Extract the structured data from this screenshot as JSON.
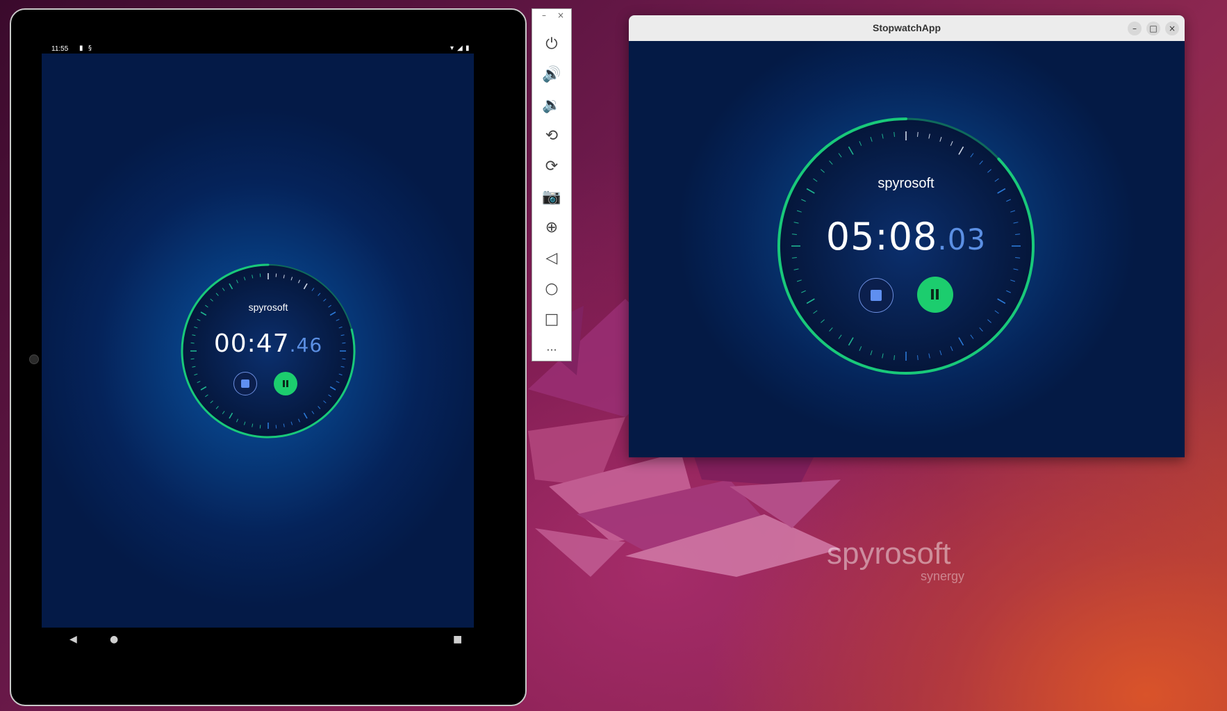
{
  "tablet": {
    "status": {
      "time": "11:55"
    },
    "stopwatch": {
      "brand": "spyrosoft",
      "time_main": "00:47",
      "time_hundredths": ".46",
      "progress": 0.79
    },
    "nav": {
      "back": "◀",
      "home": "●",
      "recents": "■"
    }
  },
  "emulator_toolbar": {
    "minimize": "–",
    "close": "×",
    "buttons": [
      {
        "name": "power-icon",
        "glyph": "⏻"
      },
      {
        "name": "volume-up-icon",
        "glyph": "🔊"
      },
      {
        "name": "volume-down-icon",
        "glyph": "🔉"
      },
      {
        "name": "rotate-left-icon",
        "glyph": "⟲"
      },
      {
        "name": "rotate-right-icon",
        "glyph": "⟳"
      },
      {
        "name": "camera-icon",
        "glyph": "📷"
      },
      {
        "name": "zoom-icon",
        "glyph": "⊕"
      },
      {
        "name": "back-icon",
        "glyph": "◁"
      },
      {
        "name": "home-icon",
        "glyph": "○"
      },
      {
        "name": "overview-icon",
        "glyph": "□"
      },
      {
        "name": "more-icon",
        "glyph": "···"
      }
    ]
  },
  "window": {
    "title": "StopwatchApp",
    "minimize": "–",
    "maximize": "□",
    "close": "×",
    "stopwatch": {
      "brand": "spyrosoft",
      "time_main": "05:08",
      "time_hundredths": ".03",
      "progress": 0.13
    }
  },
  "desktop": {
    "logo_main": "spyrosoft",
    "logo_sub": "synergy"
  },
  "colors": {
    "ring": "#19c97a",
    "tick": "#1fb0c8",
    "accent_blue": "#5b8fe3",
    "pause_green": "#1ccd6e"
  }
}
